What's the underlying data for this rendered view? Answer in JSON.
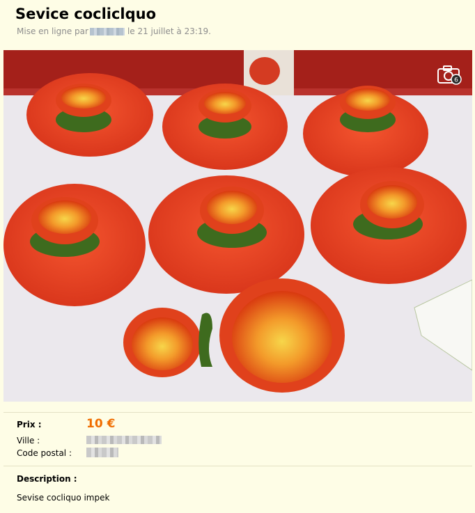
{
  "listing": {
    "title": "Sevice cocliclquo",
    "posted_prefix": "Mise en ligne par",
    "posted_suffix": "le 21 juillet à 23:19."
  },
  "photo": {
    "icon": "camera-icon",
    "badge": "6"
  },
  "details": {
    "price_label": "Prix :",
    "price_value": "10 €",
    "city_label": "Ville :",
    "postal_label": "Code postal :",
    "price_color": "#f06d00"
  },
  "description": {
    "label": "Description :",
    "text": "Sevise cocliquo impek"
  }
}
